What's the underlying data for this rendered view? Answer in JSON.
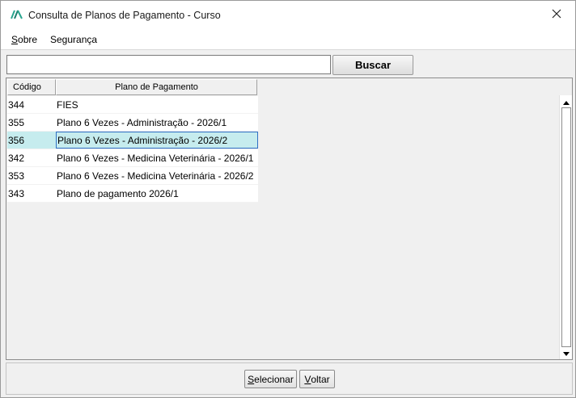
{
  "window": {
    "title": "Consulta de Planos de Pagamento - Curso",
    "close_label": "×"
  },
  "menu": {
    "items": [
      {
        "label_first": "S",
        "label_rest": "obre"
      },
      {
        "label_first": "Seg",
        "label_rest": "urança"
      }
    ]
  },
  "search": {
    "value": "",
    "button_label": "Buscar"
  },
  "table": {
    "columns": [
      "Código",
      "Plano de Pagamento"
    ],
    "rows": [
      {
        "code": "344",
        "plan": "FIES"
      },
      {
        "code": "355",
        "plan": "Plano 6 Vezes - Administração - 2026/1"
      },
      {
        "code": "356",
        "plan": "Plano 6 Vezes - Administração - 2026/2"
      },
      {
        "code": "342",
        "plan": "Plano 6 Vezes - Medicina Veterinária - 2026/1"
      },
      {
        "code": "353",
        "plan": "Plano 6 Vezes - Medicina Veterinária - 2026/2"
      },
      {
        "code": "343",
        "plan": "Plano de pagamento 2026/1"
      }
    ],
    "selected_index": 2
  },
  "buttons": {
    "select_first": "S",
    "select_rest": "elecionar",
    "back_first": "V",
    "back_rest": "oltar"
  },
  "colors": {
    "selected_row": "#c6ecee",
    "selected_border": "#2f6fc4",
    "logo": "#2aa58f"
  }
}
